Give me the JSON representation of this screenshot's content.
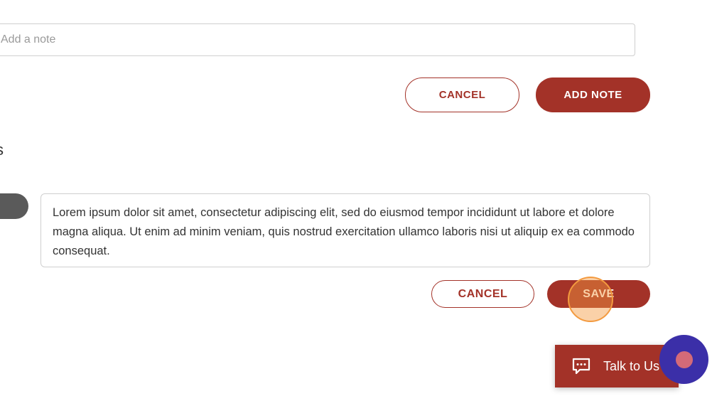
{
  "note_form": {
    "input_placeholder": "Add a note",
    "cancel_label": "CANCEL",
    "add_note_label": "ADD NOTE"
  },
  "notes_section": {
    "heading_visible": "s"
  },
  "note_edit": {
    "text": "Lorem ipsum dolor sit amet, consectetur adipiscing elit, sed do eiusmod tempor incididunt ut labore et dolore magna aliqua. Ut enim ad minim veniam, quis nostrud exercitation ullamco laboris nisi ut aliquip ex ea commodo consequat.",
    "cancel_label": "CANCEL",
    "save_label": "SAVE"
  },
  "chat_widget": {
    "label": "Talk to Us",
    "icon": "chat-bubble-icon"
  },
  "colors": {
    "accent": "#a33228",
    "fab": "#3b2fa8",
    "click_indicator": "#f39a3f"
  }
}
